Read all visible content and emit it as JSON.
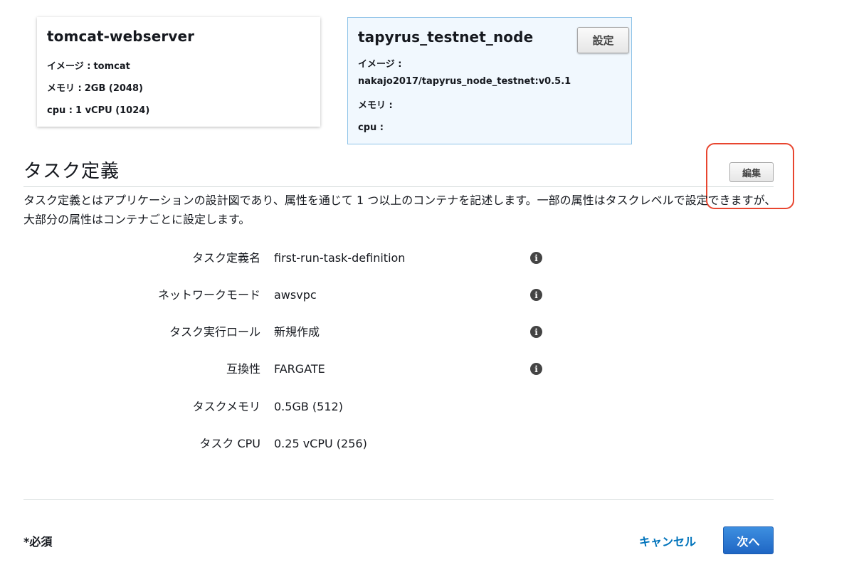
{
  "containers": [
    {
      "name": "tomcat-webserver",
      "image_label": "イメージ :",
      "image_value": "tomcat",
      "memory_label": "メモリ :",
      "memory_value": "2GB (2048)",
      "cpu_label": "cpu :",
      "cpu_value": "1 vCPU (1024)"
    },
    {
      "name": "tapyrus_testnet_node",
      "config_button": "設定",
      "image_label": "イメージ :",
      "image_value": "nakajo2017/tapyrus_node_testnet:v0.5.1",
      "memory_label": "メモリ :",
      "cpu_label": "cpu :"
    }
  ],
  "section": {
    "title": "タスク定義",
    "edit_button": "編集",
    "description": "タスク定義とはアプリケーションの設計図であり、属性を通じて 1 つ以上のコンテナを記述します。一部の属性はタスクレベルで設定できますが、大部分の属性はコンテナごとに設定します。"
  },
  "details": [
    {
      "label": "タスク定義名",
      "value": "first-run-task-definition",
      "info": true
    },
    {
      "label": "ネットワークモード",
      "value": "awsvpc",
      "info": true
    },
    {
      "label": "タスク実行ロール",
      "value": "新規作成",
      "info": true
    },
    {
      "label": "互換性",
      "value": "FARGATE",
      "info": true
    },
    {
      "label": "タスクメモリ",
      "value": "0.5GB (512)",
      "info": false
    },
    {
      "label": "タスク CPU",
      "value": "0.25 vCPU (256)",
      "info": false
    }
  ],
  "info_icon_glyph": "i",
  "footer": {
    "required": "*必須",
    "cancel": "キャンセル",
    "next": "次へ"
  },
  "colors": {
    "highlight": "#e8452f",
    "link": "#0073bb",
    "primary": "#1f66c4",
    "selected_card_bg": "#f1f8fe"
  }
}
